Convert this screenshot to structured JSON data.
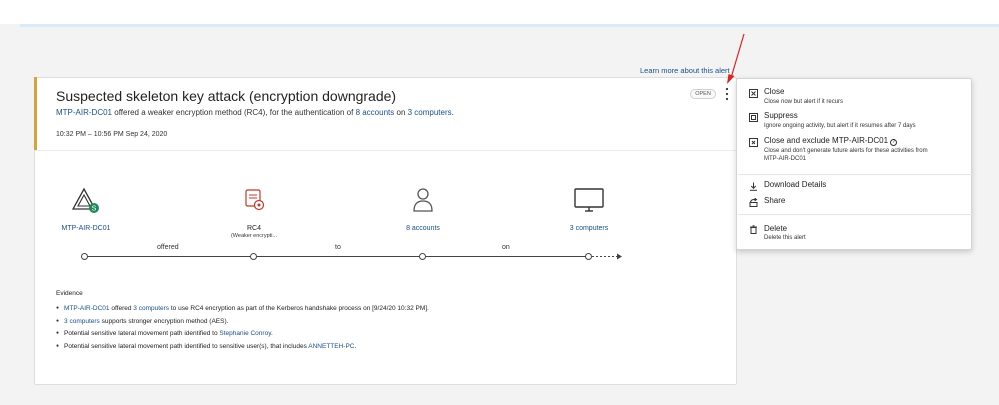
{
  "learn_more": "Learn more about this alert",
  "alert": {
    "title": "Suspected skeleton key attack (encryption downgrade)",
    "subtitle": {
      "host": "MTP-AIR-DC01",
      "text1": " offered a weaker encryption method (RC4), for the authentication of ",
      "accounts": "8 accounts",
      "text2": " on ",
      "computers": "3 computers",
      "text3": "."
    },
    "time_range": "10:32 PM – 10:56 PM Sep 24, 2020",
    "status": "OPEN"
  },
  "flow": {
    "nodes": [
      {
        "label": "MTP-AIR-DC01",
        "icon": "domain-controller-icon"
      },
      {
        "label": "RC4",
        "sub": "(Weaker encrypti...",
        "icon": "encryption-lock-icon"
      },
      {
        "label": "8 accounts",
        "icon": "user-icon"
      },
      {
        "label": "3 computers",
        "icon": "monitor-icon"
      }
    ],
    "edges": [
      "offered",
      "to",
      "on"
    ]
  },
  "evidence": {
    "title": "Evidence",
    "items": [
      {
        "a": "MTP-AIR-DC01",
        "b": " offered ",
        "c": "3 computers",
        "d": " to use RC4 encryption as part of the Kerberos handshake process on [9/24/20 10:32 PM]."
      },
      {
        "a": "3 computers",
        "b": " supports stronger encryption method (AES).",
        "c": "",
        "d": ""
      },
      {
        "a": "",
        "b": "Potential sensitive lateral movement path identified to ",
        "c": "Stephanie Conroy",
        "d": "."
      },
      {
        "a": "",
        "b": "Potential sensitive lateral movement path identified to sensitive user(s), that includes ",
        "c": "ANNETTEH-PC",
        "d": "."
      }
    ]
  },
  "menu": {
    "close": {
      "label": "Close",
      "desc": "Close now but alert if it recurs",
      "icon": "close-box-icon"
    },
    "suppress": {
      "label": "Suppress",
      "desc": "Ignore ongoing activity, but alert if it resumes after 7 days",
      "icon": "suppress-icon"
    },
    "close_exclude": {
      "label": "Close and exclude MTP-AIR-DC01",
      "desc1": "Close and don't generate future alerts for these activities from",
      "desc2": "MTP-AIR-DC01",
      "icon": "close-exclude-icon"
    },
    "download": {
      "label": "Download Details",
      "icon": "download-icon"
    },
    "share": {
      "label": "Share",
      "icon": "share-icon"
    },
    "delete": {
      "label": "Delete",
      "desc": "Delete this alert",
      "icon": "trash-icon"
    }
  },
  "colors": {
    "link": "#1a4f8b",
    "accent": "#d8a23a",
    "annotation_arrow": "#e02020",
    "dc_badge": "#1e8c5a",
    "lock_red": "#c0392b"
  }
}
